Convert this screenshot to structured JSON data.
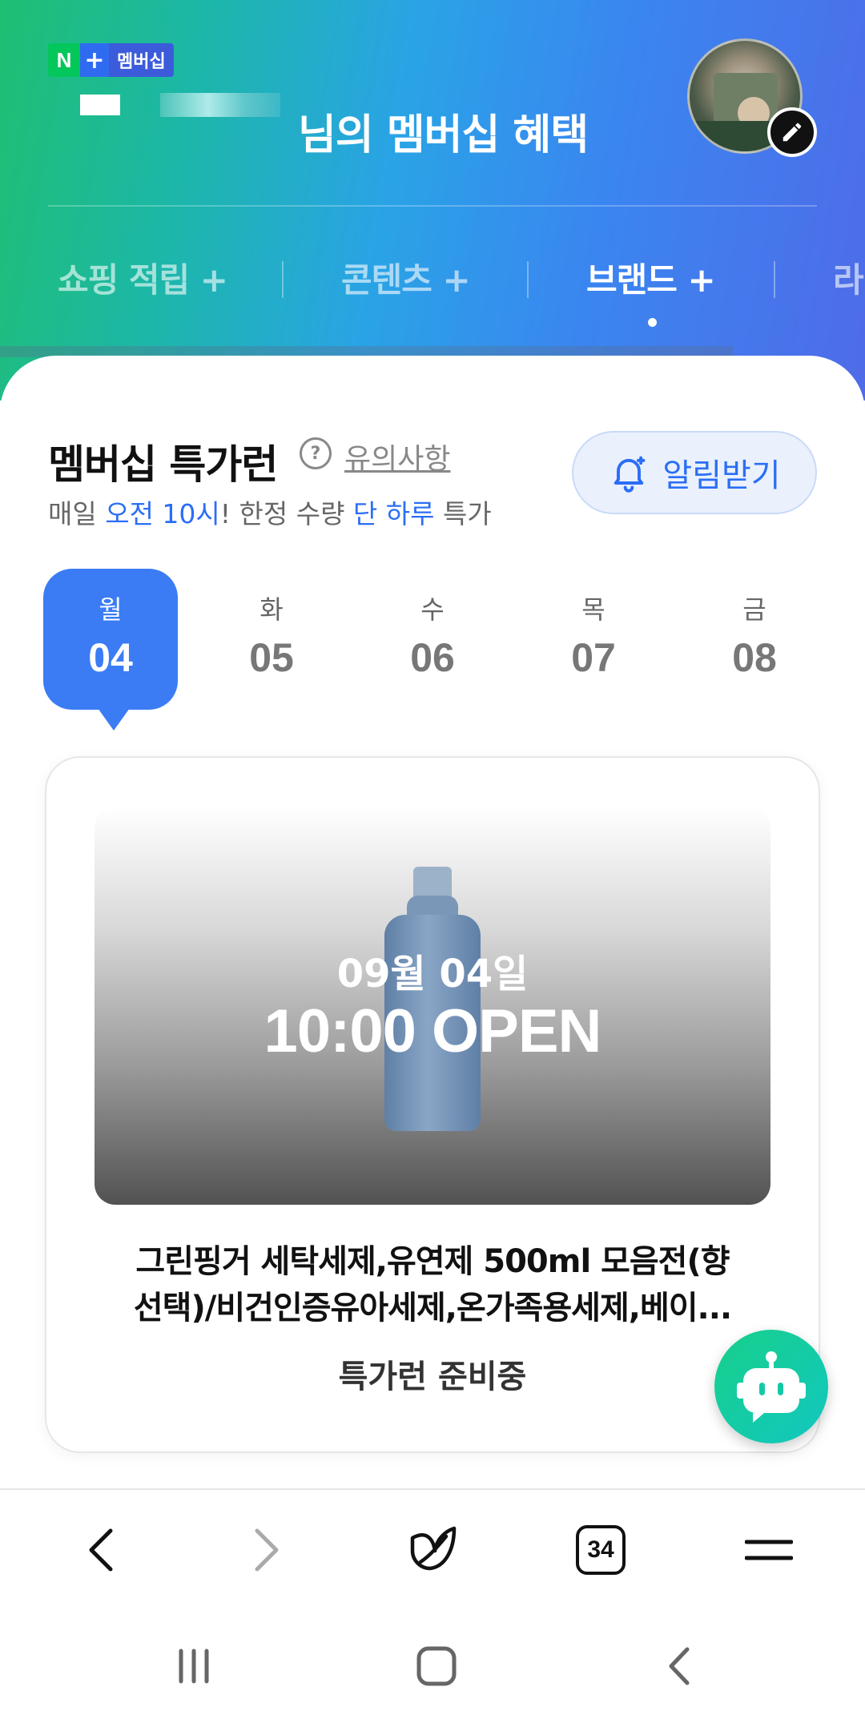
{
  "header": {
    "badge": {
      "n": "N",
      "plus": "+",
      "label": "멤버십"
    },
    "title": "님의 멤버십 혜택",
    "tabs": [
      "쇼핑 적립 +",
      "콘텐츠 +",
      "브랜드 +",
      "라"
    ],
    "active_tab_index": 2
  },
  "section": {
    "title": "멤버십 특가런",
    "help_icon": "?",
    "notice_link": "유의사항",
    "subtitle": {
      "p1": "매일 ",
      "h1": "오전 10시",
      "p2": "! 한정 수량 ",
      "h2": "단 하루",
      "p3": " 특가"
    },
    "alarm_label": "알림받기"
  },
  "days": [
    {
      "weekday": "월",
      "date": "04",
      "active": true
    },
    {
      "weekday": "화",
      "date": "05",
      "active": false
    },
    {
      "weekday": "수",
      "date": "06",
      "active": false
    },
    {
      "weekday": "목",
      "date": "07",
      "active": false
    },
    {
      "weekday": "금",
      "date": "08",
      "active": false
    }
  ],
  "deal": {
    "date_label": "09월 04일",
    "open_label": "10:00 OPEN",
    "product_line1": "그린핑거 세탁세제,유연제 500ml 모음전(향",
    "product_line2": "선택)/비건인증유아세제,온가족용세제,베이...",
    "status": "특가런 준비중"
  },
  "browser": {
    "tab_count": "34"
  },
  "colors": {
    "accent": "#3b7cf5",
    "highlight_text": "#2b6ef5",
    "bot": "#17d08a"
  },
  "icons": [
    "pencil-icon",
    "bell-icon",
    "chatbot-icon",
    "back-arrow-icon",
    "forward-arrow-icon",
    "leaf-icon",
    "menu-icon",
    "recent-apps-icon",
    "home-icon",
    "system-back-icon"
  ]
}
